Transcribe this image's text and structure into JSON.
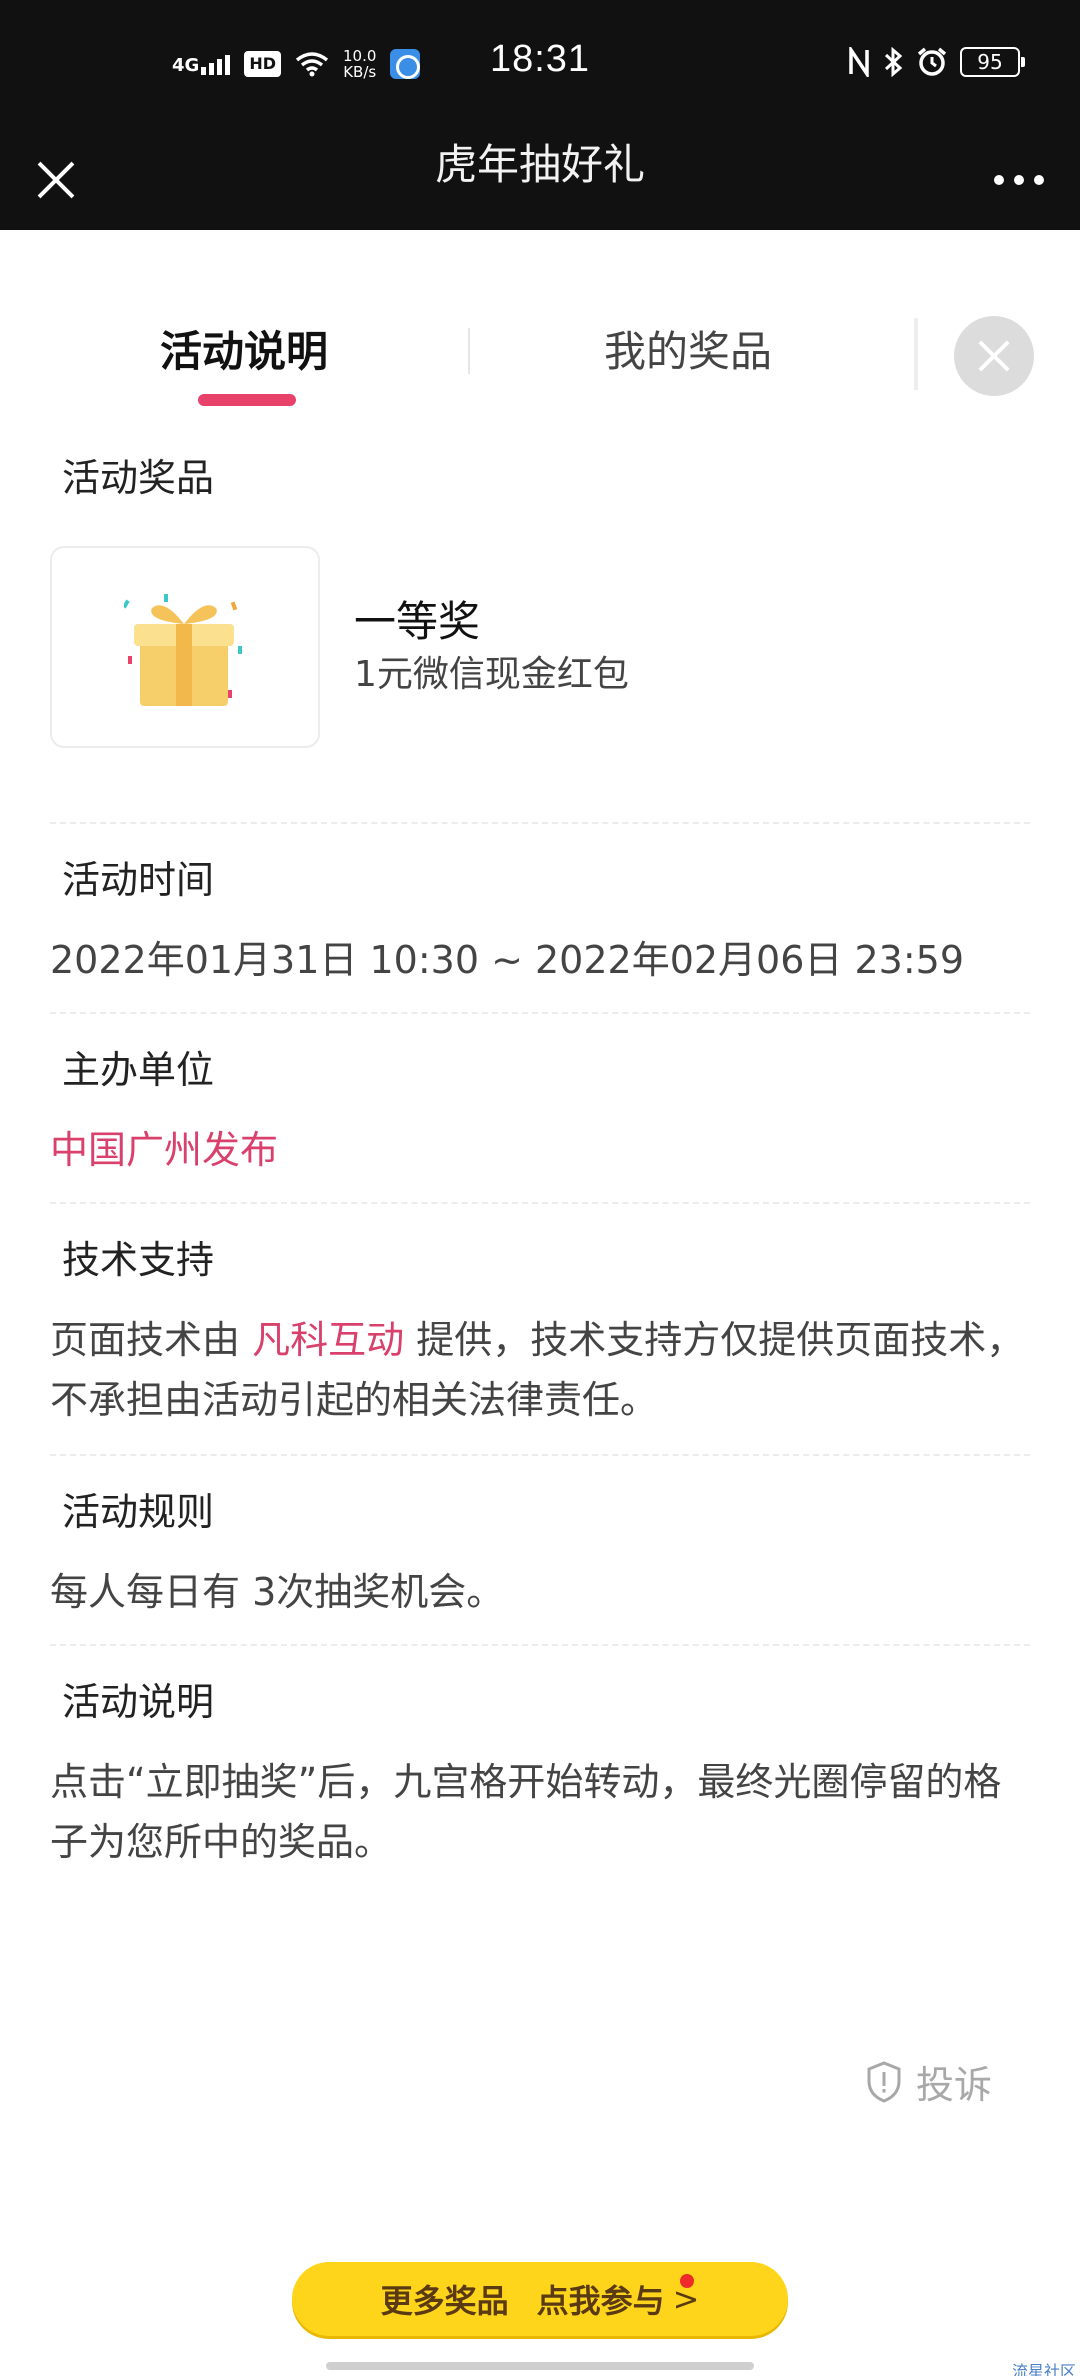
{
  "status_bar": {
    "network": "4G",
    "hd": "HD",
    "speed_top": "10.0",
    "speed_bottom": "KB/s",
    "time": "18:31",
    "battery": "95"
  },
  "title_bar": {
    "title": "虎年抽好礼"
  },
  "tabs": {
    "active": "活动说明",
    "prizes": "我的奖品"
  },
  "prizes_section": {
    "title": "活动奖品",
    "prize_level": "一等奖",
    "prize_desc": "1元微信现金红包"
  },
  "time_section": {
    "title": "活动时间",
    "text": "2022年01月31日 10:30 ~ 2022年02月06日 23:59"
  },
  "organizer_section": {
    "title": "主办单位",
    "text": "中国广州发布"
  },
  "tech_section": {
    "title": "技术支持",
    "text_before": "页面技术由 ",
    "provider": "凡科互动",
    "text_after": " 提供，技术支持方仅提供页面技术，不承担由活动引起的相关法律责任。"
  },
  "rules_section": {
    "title": "活动规则",
    "text": "每人每日有 3次抽奖机会。"
  },
  "desc_section": {
    "title": "活动说明",
    "text": "点击“立即抽奖”后，九宫格开始转动，最终光圈停留的格子为您所中的奖品。"
  },
  "complain": {
    "label": "投诉"
  },
  "bottom_button": {
    "label_a": "更多奖品",
    "label_b": "点我参与",
    "arrow": ">"
  },
  "watermark": "流星社区",
  "colors": {
    "accent": "#e8426b",
    "link": "#d9416c",
    "button": "#ffd51c"
  }
}
